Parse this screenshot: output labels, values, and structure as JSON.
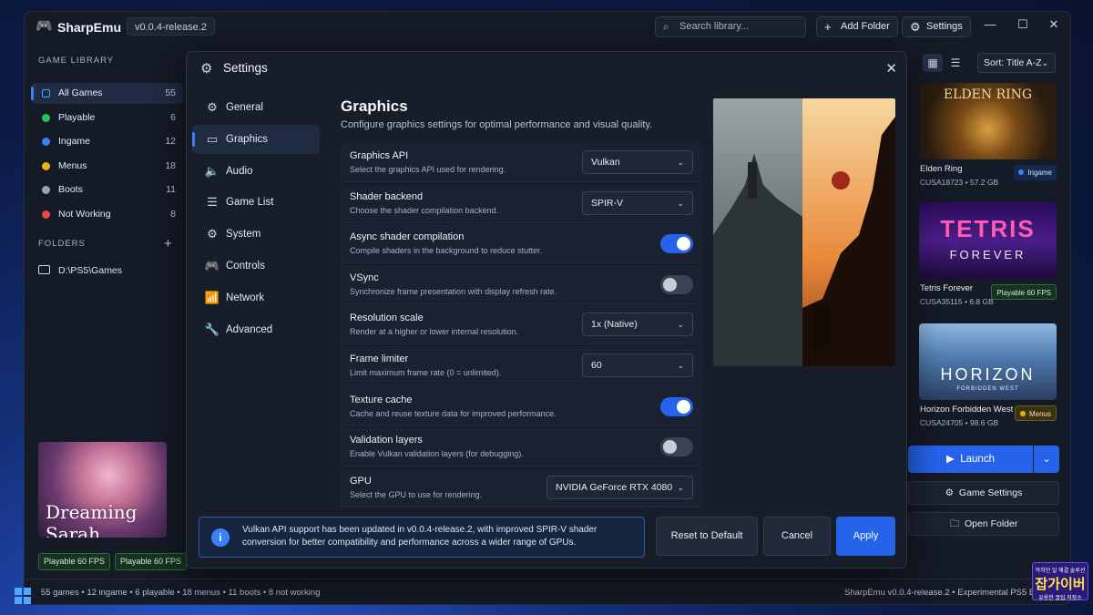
{
  "app": {
    "name": "SharpEmu",
    "version": "v0.0.4-release.2",
    "search_placeholder": "Search library...",
    "add_folder": "Add Folder",
    "settings": "Settings",
    "controls": {
      "minimize": "—",
      "maximize": "☐",
      "close": "✕"
    }
  },
  "sidebar": {
    "library_heading": "GAME LIBRARY",
    "items": [
      {
        "label": "All Games",
        "count": "55",
        "color": "#4a9eff"
      },
      {
        "label": "Playable",
        "count": "6",
        "color": "#22c55e"
      },
      {
        "label": "Ingame",
        "count": "12",
        "color": "#3b82f6"
      },
      {
        "label": "Menus",
        "count": "18",
        "color": "#eab308"
      },
      {
        "label": "Boots",
        "count": "11",
        "color": "#9ca3af"
      },
      {
        "label": "Not Working",
        "count": "8",
        "color": "#ef4444"
      }
    ],
    "folders_heading": "FOLDERS",
    "folder_path": "D:\\PS5\\Games",
    "selected_cover_title": "Dreaming Sarah",
    "tags": [
      "Playable 60 FPS",
      "Playable 60 FPS"
    ]
  },
  "library": {
    "sort": "Sort: Title A-Z",
    "games": [
      {
        "title": "Elden Ring",
        "id": "CUSA18723",
        "size": "57.2 GB",
        "status": "Ingame",
        "status_color": "#3b82f6",
        "cover_text": "ELDEN RING"
      },
      {
        "title": "Tetris Forever",
        "id": "CUSA35115",
        "size": "6.8 GB",
        "status": "Playable 60 FPS",
        "status_color": "#22c55e",
        "cover_text": "TETRIS",
        "cover_sub": "FOREVER"
      },
      {
        "title": "Horizon Forbidden West",
        "id": "CUSA24705",
        "size": "98.6 GB",
        "status": "Menus",
        "status_color": "#eab308",
        "cover_text": "HORIZON",
        "cover_sub": "FORBIDDEN WEST"
      }
    ],
    "launch": "Launch",
    "game_settings": "Game Settings",
    "open_folder": "Open Folder"
  },
  "settings_modal": {
    "title": "Settings",
    "nav": [
      "General",
      "Graphics",
      "Audio",
      "Game List",
      "System",
      "Controls",
      "Network",
      "Advanced"
    ],
    "active_nav": "Graphics",
    "page_title": "Graphics",
    "page_subtitle": "Configure graphics settings for optimal performance and visual quality.",
    "rows": [
      {
        "name": "Graphics API",
        "desc": "Select the graphics API used for rendering.",
        "type": "select",
        "value": "Vulkan"
      },
      {
        "name": "Shader backend",
        "desc": "Choose the shader compilation backend.",
        "type": "select",
        "value": "SPIR-V"
      },
      {
        "name": "Async shader compilation",
        "desc": "Compile shaders in the background to reduce stutter.",
        "type": "toggle",
        "on": true
      },
      {
        "name": "VSync",
        "desc": "Synchronize frame presentation with display refresh rate.",
        "type": "toggle",
        "on": false
      },
      {
        "name": "Resolution scale",
        "desc": "Render at a higher or lower internal resolution.",
        "type": "select",
        "value": "1x (Native)"
      },
      {
        "name": "Frame limiter",
        "desc": "Limit maximum frame rate (0 = unlimited).",
        "type": "select",
        "value": "60"
      },
      {
        "name": "Texture cache",
        "desc": "Cache and reuse texture data for improved performance.",
        "type": "toggle",
        "on": true
      },
      {
        "name": "Validation layers",
        "desc": "Enable Vulkan validation layers (for debugging).",
        "type": "toggle",
        "on": false
      },
      {
        "name": "GPU",
        "desc": "Select the GPU to use for rendering.",
        "type": "select",
        "value": "NVIDIA GeForce RTX 4080"
      }
    ],
    "info": "Vulkan API support has been updated in v0.0.4-release.2, with improved SPIR-V shader conversion for better compatibility and performance across a wider range of GPUs.",
    "reset": "Reset to Default",
    "cancel": "Cancel",
    "apply": "Apply"
  },
  "statusbar": {
    "left": "55 games • 12 ingame • 6 playable • 18 menus • 11 boots • 8 not working",
    "right": "SharpEmu v0.0.4-release.2 • Experimental PS5 Em"
  },
  "watermark": {
    "line1": "막히던 일 해결 솔루션",
    "line2": "잡가이버",
    "line3": "유용한 꿀팁 저장소"
  }
}
